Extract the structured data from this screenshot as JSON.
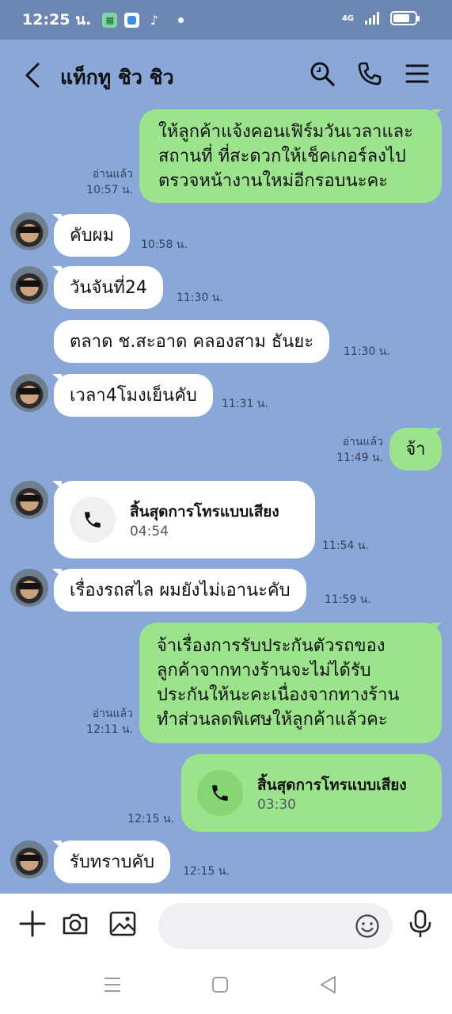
{
  "status_bar": {
    "time": "12:25 น.",
    "network": "4G"
  },
  "header": {
    "title": "แท็กทู ชิว ชิว"
  },
  "messages": [
    {
      "dir": "out",
      "lines": [
        "ให้ลูกค้าแจ้งคอนเฟิร์มวันเวลาและ",
        "สถานที่ ที่สะดวกให้เช็คเกอร์ลงไป",
        "ตรวจหน้างานใหม่อีกรอบนะคะ"
      ],
      "read": "อ่านแล้ว",
      "time": "10:57 น."
    },
    {
      "dir": "in",
      "text": "คับผม",
      "time": "10:58 น."
    },
    {
      "dir": "in",
      "text": "วันจันที่24",
      "time": "11:30 น."
    },
    {
      "dir": "in",
      "text": "ตลาด ช.สะอาด คลองสาม ธันยะ",
      "time": "11:30 น."
    },
    {
      "dir": "in",
      "text": "เวลา4โมงเย็นคับ",
      "time": "11:31 น."
    },
    {
      "dir": "out",
      "text": "จ้า",
      "read": "อ่านแล้ว",
      "time": "11:49 น."
    },
    {
      "dir": "in",
      "call_title": "สิ้นสุดการโทรแบบเสียง",
      "call_duration": "04:54",
      "time": "11:54 น."
    },
    {
      "dir": "in",
      "text": "เรื่องรถสไล ผมยังไม่เอานะคับ",
      "time": "11:59 น."
    },
    {
      "dir": "out",
      "lines": [
        "จ้าเรื่องการรับประกันตัวรถของ",
        "ลูกค้าจากทางร้านจะไม่ได้รับ",
        "ประกันให้นะคะเนื่องจากทางร้าน",
        "ทำส่วนลดพิเศษให้ลูกค้าแล้วคะ"
      ],
      "read": "อ่านแล้ว",
      "time": "12:11 น."
    },
    {
      "dir": "out",
      "call_title": "สิ้นสุดการโทรแบบเสียง",
      "call_duration": "03:30",
      "time": "12:15 น."
    },
    {
      "dir": "in",
      "text": "รับทราบคับ",
      "time": "12:15 น."
    }
  ],
  "input": {
    "placeholder": ""
  },
  "colors": {
    "chat_background": "#8aa7d9",
    "outgoing_bubble": "#9be48b",
    "incoming_bubble": "#ffffff",
    "status_bar": "#6d87b4"
  },
  "icons": [
    "back-arrow-icon",
    "search-icon",
    "phone-icon",
    "menu-icon",
    "plus-icon",
    "camera-icon",
    "image-icon",
    "emoji-icon",
    "microphone-icon",
    "recents-icon",
    "home-icon",
    "nav-back-icon"
  ]
}
